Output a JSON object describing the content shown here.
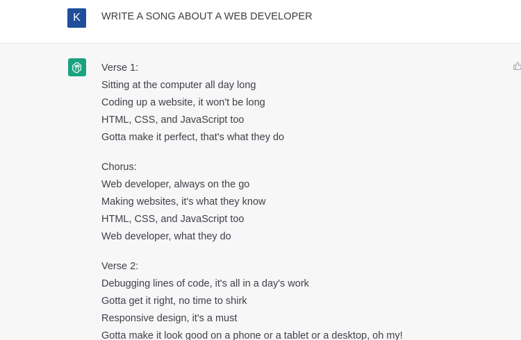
{
  "user_message": {
    "avatar_letter": "K",
    "text": "WRITE A SONG ABOUT A WEB DEVELOPER"
  },
  "assistant_message": {
    "avatar_icon": "openai-logo-icon",
    "verse1_heading": "Verse 1:",
    "verse1_lines": [
      "Sitting at the computer all day long",
      "Coding up a website, it won't be long",
      "HTML, CSS, and JavaScript too",
      "Gotta make it perfect, that's what they do"
    ],
    "chorus_heading": "Chorus:",
    "chorus_lines": [
      "Web developer, always on the go",
      "Making websites, it's what they know",
      "HTML, CSS, and JavaScript too",
      "Web developer, what they do"
    ],
    "verse2_heading": "Verse 2:",
    "verse2_lines": [
      "Debugging lines of code, it's all in a day's work",
      "Gotta get it right, no time to shirk",
      "Responsive design, it's a must",
      "Gotta make it look good on a phone or a tablet or a desktop, oh my!"
    ]
  },
  "colors": {
    "user_avatar_bg": "#1f4f9c",
    "bot_avatar_bg": "#19a37f",
    "assistant_row_bg": "#f7f7f8"
  },
  "icons": {
    "feedback": "thumbs-up-icon"
  }
}
